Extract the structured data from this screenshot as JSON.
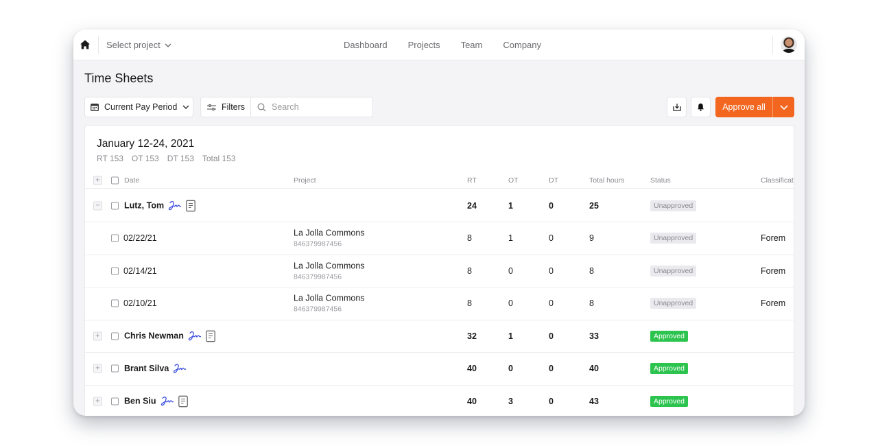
{
  "topbar": {
    "select_project": "Select project",
    "nav": [
      "Dashboard",
      "Projects",
      "Team",
      "Company"
    ]
  },
  "page": {
    "title": "Time Sheets"
  },
  "toolbar": {
    "period_label": "Current Pay Period",
    "filters_label": "Filters",
    "search_placeholder": "Search",
    "approve_label": "Approve all"
  },
  "colors": {
    "accent": "#f2661f",
    "approved": "#2cc44e",
    "unapproved_bg": "#e9e9ee",
    "signature": "#3f51e0"
  },
  "period": {
    "title": "January 12-24, 2021",
    "totals": [
      "RT 153",
      "OT 153",
      "DT 153",
      "Total 153"
    ]
  },
  "table": {
    "headers": {
      "date": "Date",
      "project": "Project",
      "rt": "RT",
      "ot": "OT",
      "dt": "DT",
      "total": "Total hours",
      "status": "Status",
      "classification": "Classificat"
    },
    "rows": [
      {
        "type": "group",
        "expanded": true,
        "name": "Lutz, Tom",
        "has_doc": true,
        "rt": "24",
        "ot": "1",
        "dt": "0",
        "total": "25",
        "status": "Unapproved"
      },
      {
        "type": "entry",
        "date": "02/22/21",
        "project": "La Jolla Commons",
        "project_id": "846379987456",
        "rt": "8",
        "ot": "1",
        "dt": "0",
        "total": "9",
        "status": "Unapproved",
        "classification": "Forem"
      },
      {
        "type": "entry",
        "date": "02/14/21",
        "project": "La Jolla Commons",
        "project_id": "846379987456",
        "rt": "8",
        "ot": "0",
        "dt": "0",
        "total": "8",
        "status": "Unapproved",
        "classification": "Forem"
      },
      {
        "type": "entry",
        "date": "02/10/21",
        "project": "La Jolla Commons",
        "project_id": "846379987456",
        "rt": "8",
        "ot": "0",
        "dt": "0",
        "total": "8",
        "status": "Unapproved",
        "classification": "Forem"
      },
      {
        "type": "group",
        "expanded": false,
        "name": "Chris Newman",
        "has_doc": true,
        "rt": "32",
        "ot": "1",
        "dt": "0",
        "total": "33",
        "status": "Approved"
      },
      {
        "type": "group",
        "expanded": false,
        "name": "Brant Silva",
        "has_doc": false,
        "rt": "40",
        "ot": "0",
        "dt": "0",
        "total": "40",
        "status": "Approved"
      },
      {
        "type": "group",
        "expanded": false,
        "name": "Ben Siu",
        "has_doc": true,
        "rt": "40",
        "ot": "3",
        "dt": "0",
        "total": "43",
        "status": "Approved"
      }
    ]
  },
  "icons": {
    "expanded": "−",
    "collapsed": "+"
  }
}
